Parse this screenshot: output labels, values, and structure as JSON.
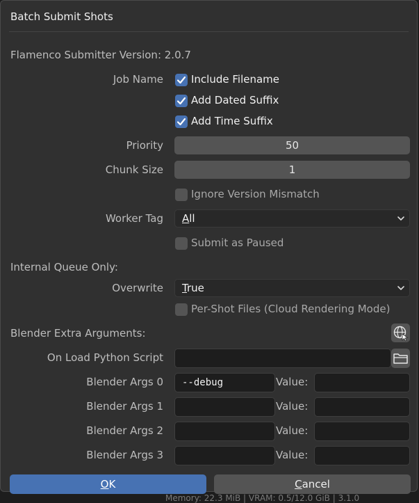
{
  "dialog": {
    "title": "Batch Submit Shots",
    "version_text": "Flamenco Submitter Version: 2.0.7"
  },
  "job_name": {
    "label": "Job Name",
    "include_filename": {
      "label": "Include Filename",
      "checked": true
    },
    "add_dated_suffix": {
      "label": "Add Dated Suffix",
      "checked": true
    },
    "add_time_suffix": {
      "label": "Add Time Suffix",
      "checked": true
    }
  },
  "priority": {
    "label": "Priority",
    "value": "50"
  },
  "chunk_size": {
    "label": "Chunk Size",
    "value": "1"
  },
  "ignore_version_mismatch": {
    "label": "Ignore Version Mismatch",
    "checked": false
  },
  "worker_tag": {
    "label": "Worker Tag",
    "value": "All",
    "underline": "A",
    "rest": "ll"
  },
  "submit_paused": {
    "label": "Submit as Paused",
    "checked": false
  },
  "internal_queue": {
    "heading": "Internal Queue Only:",
    "overwrite_label": "Overwrite",
    "overwrite_value": "True",
    "overwrite_underline": "T",
    "overwrite_rest": "rue",
    "per_shot_files": {
      "label": "Per-Shot Files (Cloud Rendering Mode)",
      "checked": false
    }
  },
  "extra_args": {
    "heading": "Blender Extra Arguments:",
    "on_load_label": "On Load Python Script",
    "on_load_value": "",
    "value_label": "Value:",
    "rows": [
      {
        "label": "Blender Args 0",
        "arg": "--debug",
        "value": ""
      },
      {
        "label": "Blender Args 1",
        "arg": "",
        "value": ""
      },
      {
        "label": "Blender Args 2",
        "arg": "",
        "value": ""
      },
      {
        "label": "Blender Args 3",
        "arg": "",
        "value": ""
      }
    ]
  },
  "buttons": {
    "ok_underline": "O",
    "ok_rest": "K",
    "cancel_underline": "C",
    "cancel_rest": "ancel"
  },
  "background": {
    "partial_text": "Memory: 22.3 MiB | VRAM: 0.5/12.0 GiB | 3.1.0"
  },
  "colors": {
    "accent": "#4772b3",
    "panel": "#303030",
    "field": "#545454"
  },
  "icons": [
    "checkmark-icon",
    "chevron-down-icon",
    "globe-cursor-icon",
    "folder-icon"
  ]
}
